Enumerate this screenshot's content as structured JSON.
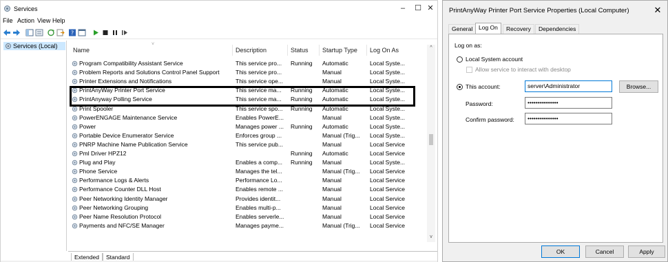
{
  "services_window": {
    "title": "Services",
    "menu": [
      "File",
      "Action",
      "View",
      "Help"
    ],
    "tree_item": "Services (Local)",
    "columns": {
      "name": "Name",
      "description": "Description",
      "status": "Status",
      "startup": "Startup Type",
      "logon": "Log On As"
    },
    "rows": [
      {
        "name": "Program Compatibility Assistant Service",
        "desc": "This service pro...",
        "status": "Running",
        "startup": "Automatic",
        "logon": "Local Syste..."
      },
      {
        "name": "Problem Reports and Solutions Control Panel Support",
        "desc": "This service pro...",
        "status": "",
        "startup": "Manual",
        "logon": "Local Syste..."
      },
      {
        "name": "Printer Extensions and Notifications",
        "desc": "This service ope...",
        "status": "",
        "startup": "Manual",
        "logon": "Local Syste..."
      },
      {
        "name": "PrintAnyWay Printer Port Service",
        "desc": "This service ma...",
        "status": "Running",
        "startup": "Automatic",
        "logon": "Local Syste..."
      },
      {
        "name": "PrintAnyway Polling Service",
        "desc": "This service ma...",
        "status": "Running",
        "startup": "Automatic",
        "logon": "Local Syste..."
      },
      {
        "name": "Print Spooler",
        "desc": "This service spo...",
        "status": "Running",
        "startup": "Automatic",
        "logon": "Local Syste..."
      },
      {
        "name": "PowerENGAGE Maintenance Service",
        "desc": "Enables PowerE...",
        "status": "",
        "startup": "Manual",
        "logon": "Local Syste..."
      },
      {
        "name": "Power",
        "desc": "Manages power ...",
        "status": "Running",
        "startup": "Automatic",
        "logon": "Local Syste..."
      },
      {
        "name": "Portable Device Enumerator Service",
        "desc": "Enforces group ...",
        "status": "",
        "startup": "Manual (Trig...",
        "logon": "Local Syste..."
      },
      {
        "name": "PNRP Machine Name Publication Service",
        "desc": "This service pub...",
        "status": "",
        "startup": "Manual",
        "logon": "Local Service"
      },
      {
        "name": "Pml Driver HPZ12",
        "desc": "",
        "status": "Running",
        "startup": "Automatic",
        "logon": "Local Service"
      },
      {
        "name": "Plug and Play",
        "desc": "Enables a comp...",
        "status": "Running",
        "startup": "Manual",
        "logon": "Local Syste..."
      },
      {
        "name": "Phone Service",
        "desc": "Manages the tel...",
        "status": "",
        "startup": "Manual (Trig...",
        "logon": "Local Service"
      },
      {
        "name": "Performance Logs & Alerts",
        "desc": "Performance Lo...",
        "status": "",
        "startup": "Manual",
        "logon": "Local Service"
      },
      {
        "name": "Performance Counter DLL Host",
        "desc": "Enables remote ...",
        "status": "",
        "startup": "Manual",
        "logon": "Local Service"
      },
      {
        "name": "Peer Networking Identity Manager",
        "desc": "Provides identit...",
        "status": "",
        "startup": "Manual",
        "logon": "Local Service"
      },
      {
        "name": "Peer Networking Grouping",
        "desc": "Enables multi-p...",
        "status": "",
        "startup": "Manual",
        "logon": "Local Service"
      },
      {
        "name": "Peer Name Resolution Protocol",
        "desc": "Enables serverle...",
        "status": "",
        "startup": "Manual",
        "logon": "Local Service"
      },
      {
        "name": "Payments and NFC/SE Manager",
        "desc": "Manages payme...",
        "status": "",
        "startup": "Manual (Trig...",
        "logon": "Local Service"
      }
    ],
    "bottom_tabs": [
      "Extended",
      "Standard"
    ]
  },
  "dialog": {
    "title": "PrintAnyWay Printer Port Service Properties (Local Computer)",
    "tabs": [
      "General",
      "Log On",
      "Recovery",
      "Dependencies"
    ],
    "active_tab": "Log On",
    "logon_as": "Log on as:",
    "local_system": "Local System account",
    "allow_interact": "Allow service to interact with desktop",
    "this_account": "This account:",
    "account_value": "server\\Administrator",
    "browse": "Browse...",
    "password_label": "Password:",
    "password_value": "•••••••••••••••",
    "confirm_label": "Confirm password:",
    "confirm_value": "•••••••••••••••",
    "ok": "OK",
    "cancel": "Cancel",
    "apply": "Apply"
  },
  "colors": {
    "selection": "#cce8ff",
    "accent": "#0078d7",
    "highlight_border": "#000000"
  }
}
